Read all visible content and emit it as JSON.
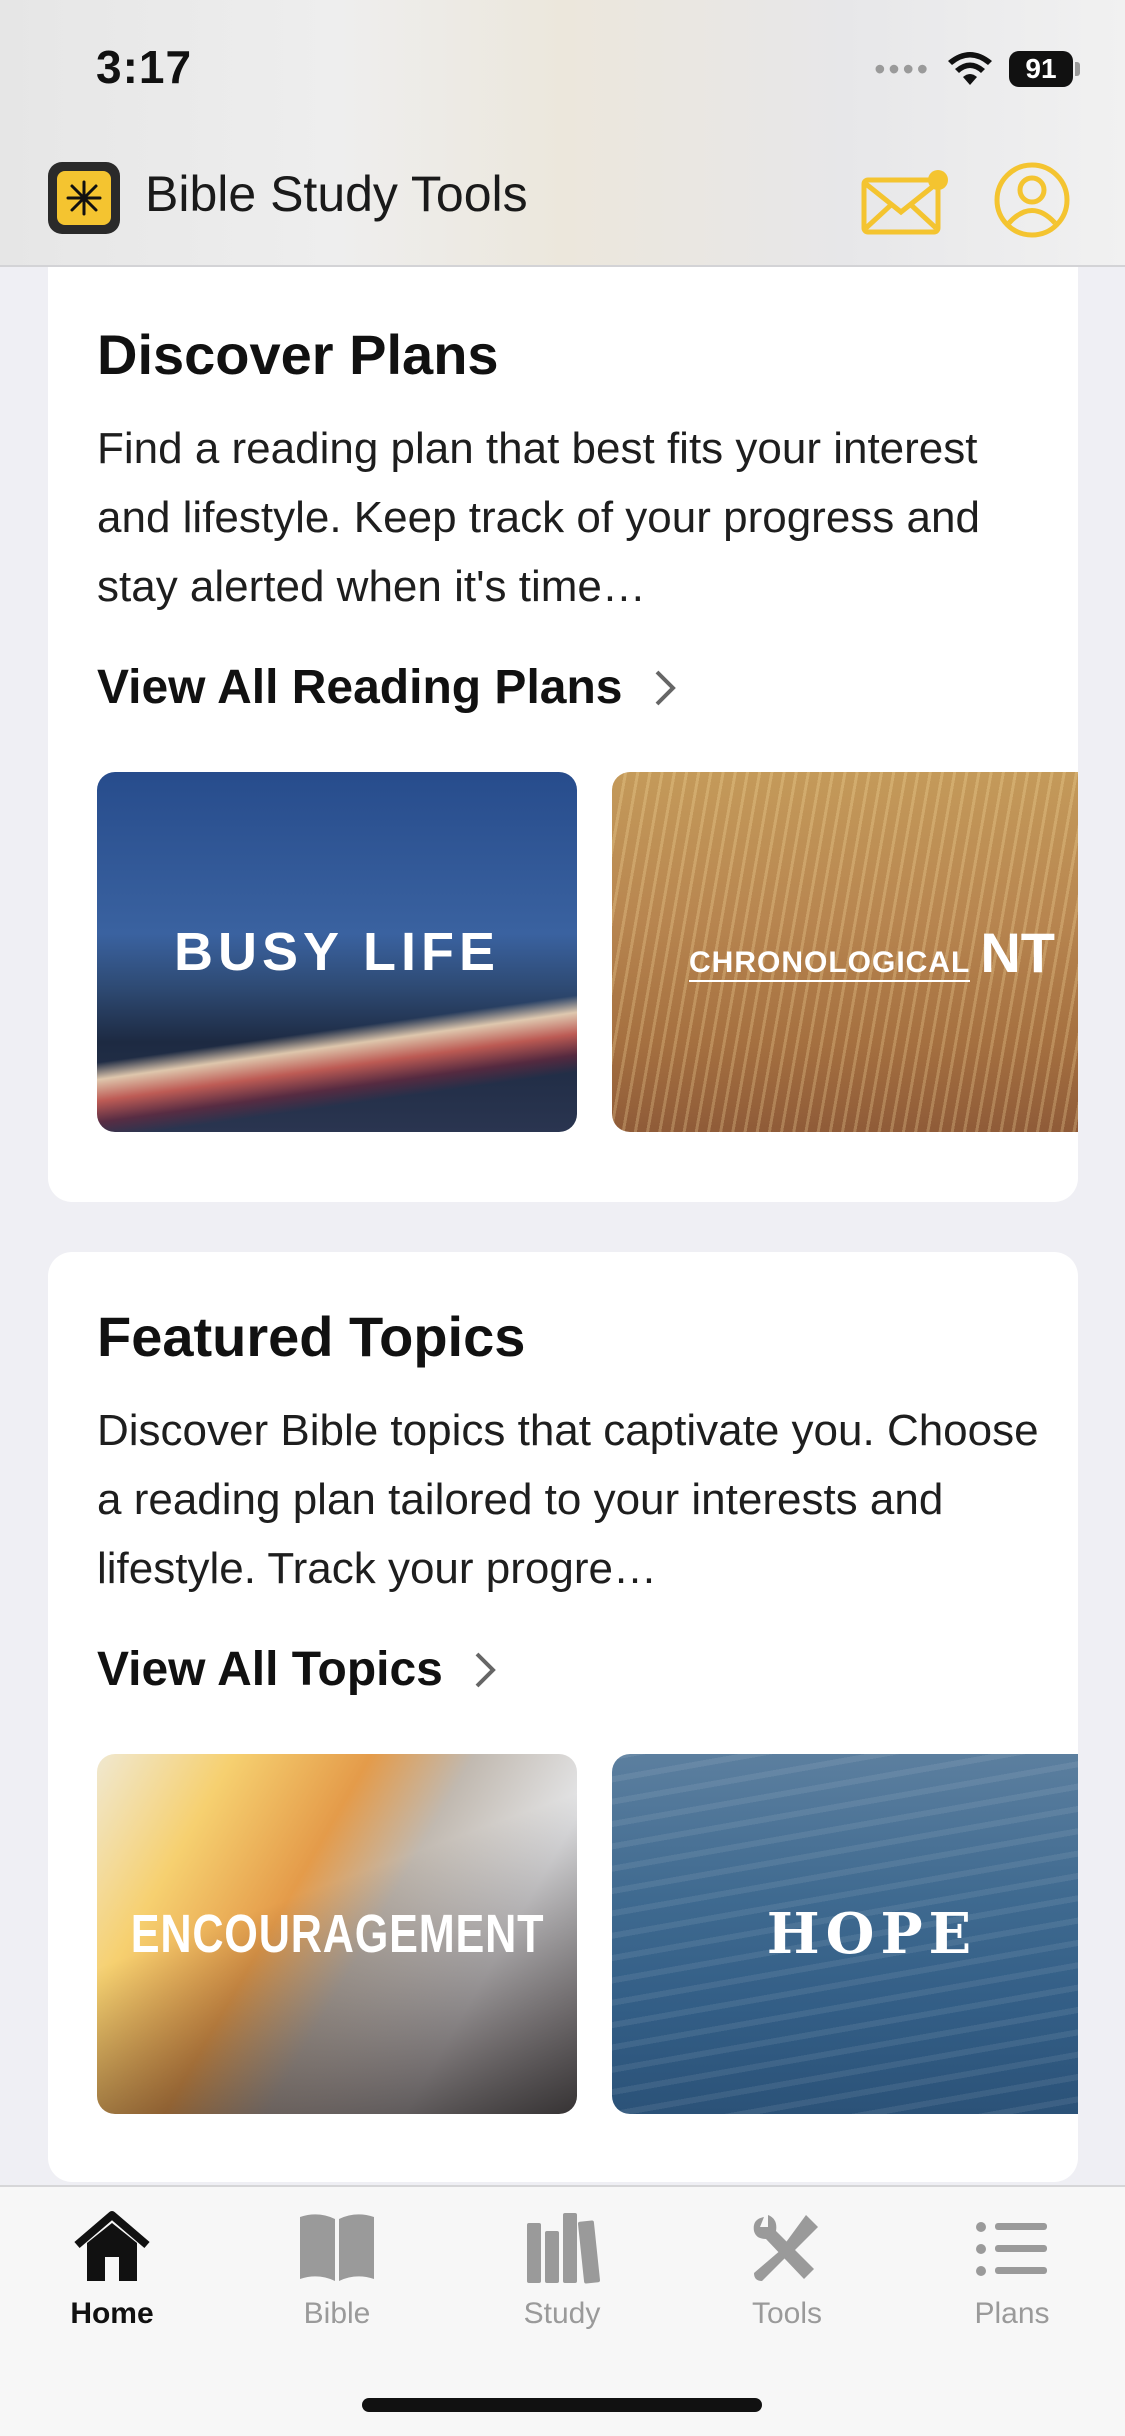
{
  "status_bar": {
    "time": "3:17",
    "battery": "91"
  },
  "header": {
    "app_title": "Bible Study Tools",
    "accent_color": "#f4c430"
  },
  "discover": {
    "title": "Discover Plans",
    "description": "Find a reading plan that best fits your interest and lifestyle. Keep track of your progress and stay alerted when it's time…",
    "link": "View All Reading Plans",
    "items": [
      {
        "label": "BUSY LIFE"
      },
      {
        "label_prefix": "CHRONOLOGICAL",
        "label_suffix": "NT"
      }
    ]
  },
  "topics": {
    "title": "Featured Topics",
    "description": "Discover Bible topics that captivate you. Choose a reading plan tailored to your interests and lifestyle. Track your progre…",
    "link": "View All Topics",
    "items": [
      {
        "label": "ENCOURAGEMENT"
      },
      {
        "label": "HOPE"
      }
    ]
  },
  "tabbar": {
    "items": [
      {
        "label": "Home",
        "icon": "home-icon",
        "active": true
      },
      {
        "label": "Bible",
        "icon": "bible-icon",
        "active": false
      },
      {
        "label": "Study",
        "icon": "study-icon",
        "active": false
      },
      {
        "label": "Tools",
        "icon": "tools-icon",
        "active": false
      },
      {
        "label": "Plans",
        "icon": "plans-icon",
        "active": false
      }
    ]
  }
}
